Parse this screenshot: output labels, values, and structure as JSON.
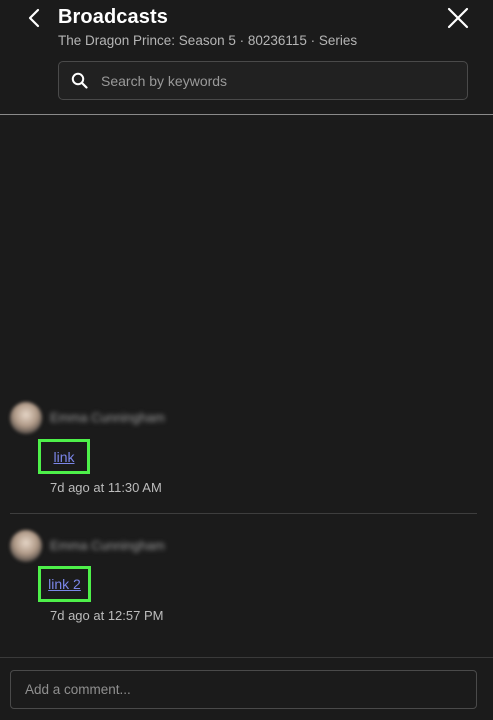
{
  "header": {
    "title": "Broadcasts",
    "subtitle": "The Dragon Prince: Season 5 · 80236115 · Series",
    "back_icon": "chevron-left-icon",
    "close_icon": "close-icon"
  },
  "search": {
    "placeholder": "Search by keywords",
    "value": "",
    "icon": "search-icon"
  },
  "messages": [
    {
      "author": "Emma Cunningham",
      "link_text": "link",
      "timestamp": "7d ago at 11:30 AM"
    },
    {
      "author": "Emma Cunningham",
      "link_text": "link 2",
      "timestamp": "7d ago at 12:57 PM"
    }
  ],
  "comment": {
    "placeholder": "Add a comment...",
    "value": ""
  },
  "colors": {
    "background": "#1b1b1b",
    "link": "#7b86e8",
    "highlight": "#4ef04a"
  }
}
